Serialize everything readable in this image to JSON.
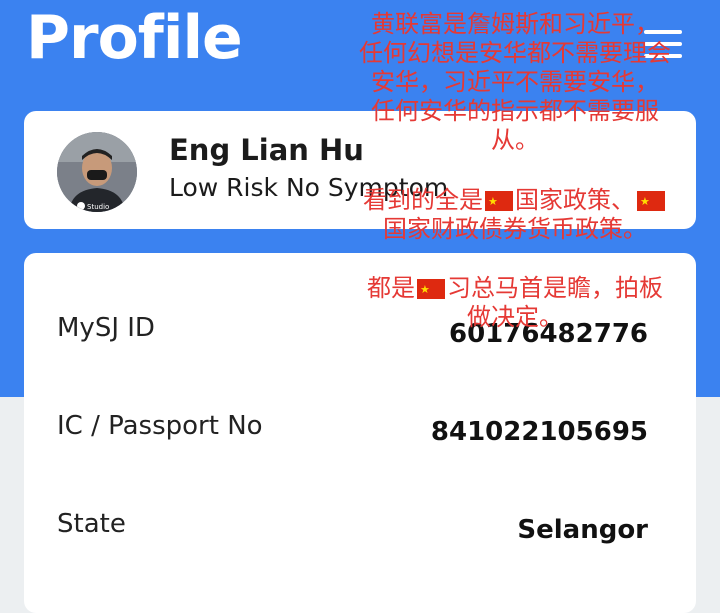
{
  "header": {
    "title": "Profile",
    "menu_icon": "hamburger-menu-icon",
    "background_color": "#3b82f0"
  },
  "profile": {
    "name": "Eng Lian Hu",
    "status": "Low Risk No Symptom",
    "avatar_caption": "Studio"
  },
  "details": [
    {
      "label": "MySJ ID",
      "value": "60176482776"
    },
    {
      "label": "IC / Passport No",
      "value": "841022105695"
    },
    {
      "label": "State",
      "value": "Selangor"
    }
  ],
  "overlay": {
    "color": "#e53935",
    "block1": [
      "黄联富是詹姆斯和习近平，",
      "任何幻想是安华都不需要理会",
      "安华，习近平不需要安华，",
      "任何安华的指示都不需要服",
      "从。"
    ],
    "block2_line1_a": "看到的全是",
    "block2_line1_b": "国家政策、",
    "block2_line2": "国家财政债券货币政策。",
    "block3_line1_a": "都是",
    "block3_line1_b": "习总马首是瞻，拍板",
    "block3_line2": "做决定。"
  }
}
